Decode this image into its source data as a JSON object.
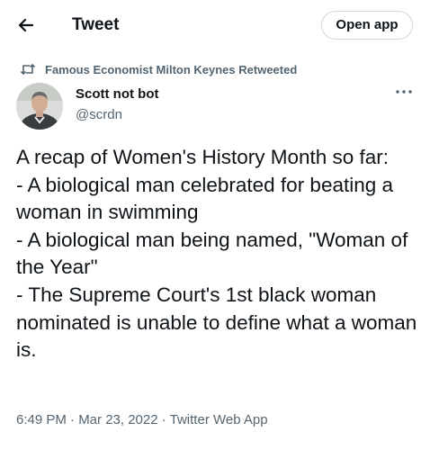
{
  "header": {
    "title": "Tweet",
    "open_app_label": "Open app"
  },
  "icons": {
    "back": "arrow-left-icon",
    "retweet": "retweet-icon",
    "more": "more-horizontal-icon"
  },
  "retweet_context": {
    "text": "Famous Economist Milton Keynes Retweeted"
  },
  "author": {
    "display_name": "Scott not bot",
    "handle": "@scrdn"
  },
  "tweet": {
    "text": "A recap of Women's History Month so far:\n- A biological man celebrated for beating a woman in swimming\n- A biological man being named, \"Woman of the Year\"\n- The Supreme Court's 1st black woman nominated is unable to define what a woman is.",
    "meta": "6:49 PM · Mar 23, 2022 · Twitter Web App"
  },
  "colors": {
    "primary_text": "#0f1419",
    "secondary_text": "#536471",
    "border": "#cfd9de",
    "background": "#ffffff"
  }
}
